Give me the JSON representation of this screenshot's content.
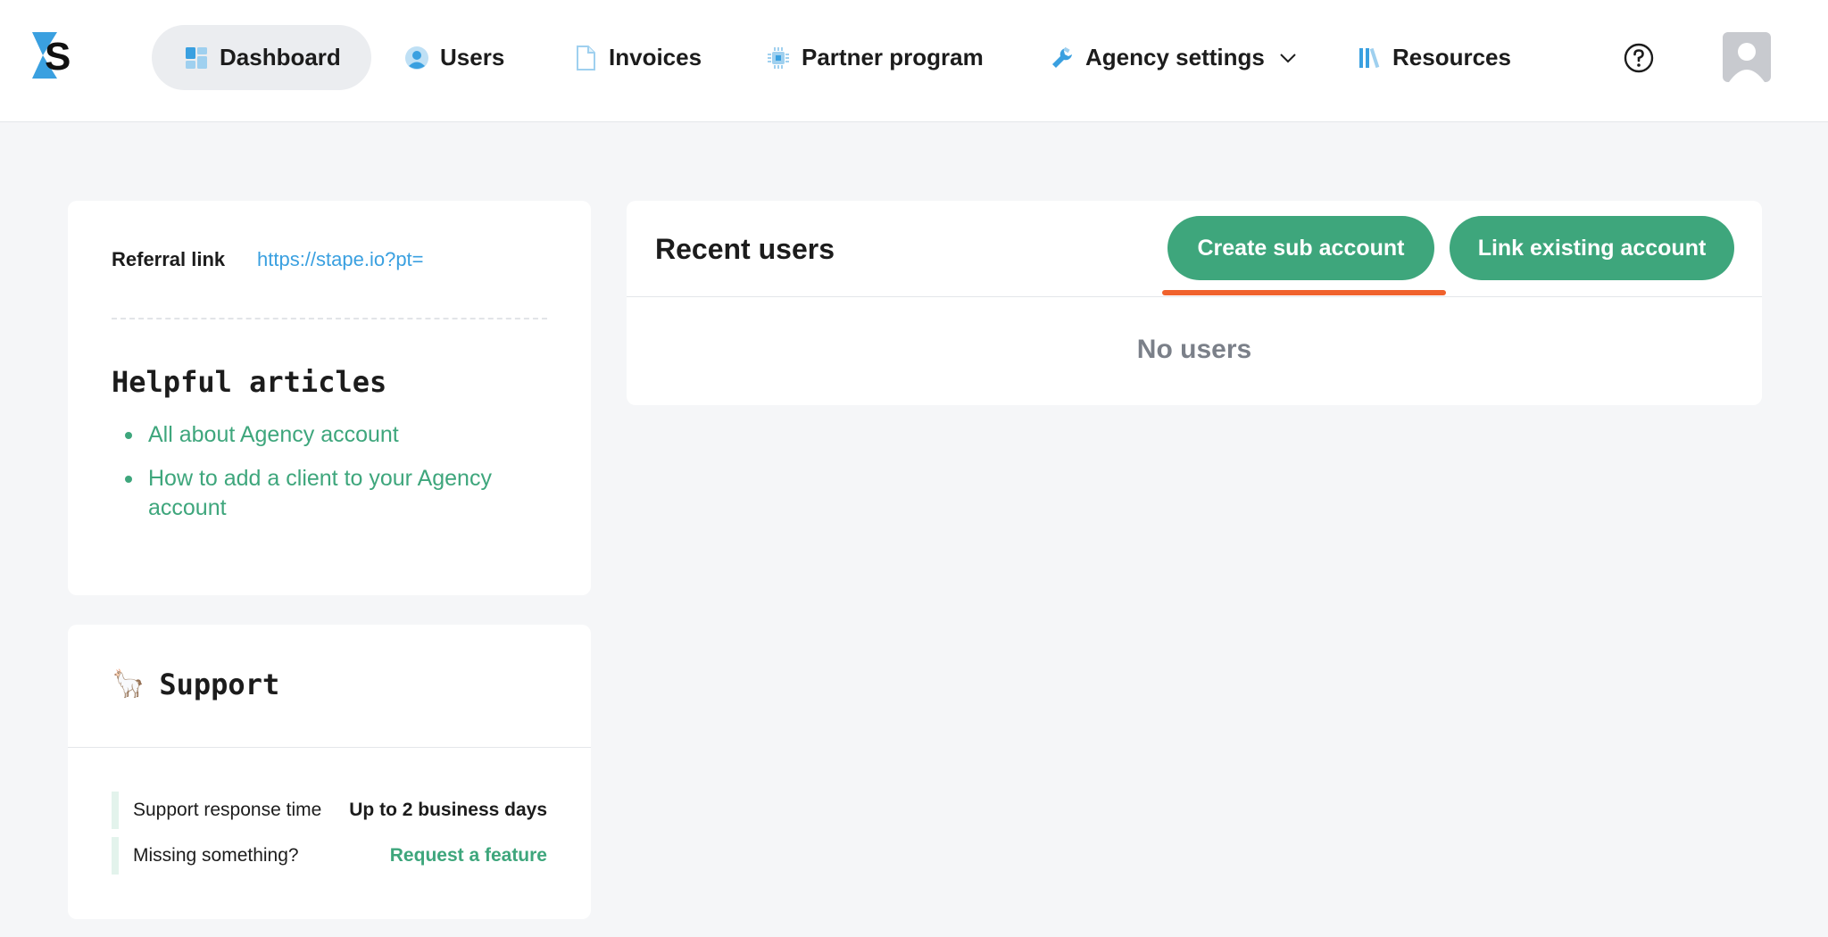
{
  "brand": {
    "logo_icon": "stape-logo",
    "accent_green": "#3ea67c",
    "link_blue": "#3aa0e0",
    "highlight_orange": "#f0622d"
  },
  "nav": {
    "items": [
      {
        "label": "Dashboard",
        "icon": "dashboard-icon",
        "active": true
      },
      {
        "label": "Users",
        "icon": "user-circle-icon"
      },
      {
        "label": "Invoices",
        "icon": "document-icon"
      },
      {
        "label": "Partner program",
        "icon": "chip-icon"
      },
      {
        "label": "Agency settings",
        "icon": "wrench-icon",
        "dropdown": true
      },
      {
        "label": "Resources",
        "icon": "library-icon"
      }
    ],
    "help_icon": "question-circle-icon",
    "avatar_icon": "user-avatar-icon"
  },
  "referral": {
    "label": "Referral link",
    "url": "https://stape.io?pt="
  },
  "articles": {
    "title": "Helpful articles",
    "items": [
      "All about Agency account",
      "How to add a client to your Agency account"
    ]
  },
  "support": {
    "emoji": "🦙",
    "title": "Support",
    "rows": [
      {
        "key": "Support response time",
        "value": "Up to 2 business days"
      },
      {
        "key": "Missing something?",
        "link": "Request a feature"
      }
    ]
  },
  "users": {
    "title": "Recent users",
    "create_button": "Create sub account",
    "link_button": "Link existing account",
    "empty_text": "No users"
  }
}
